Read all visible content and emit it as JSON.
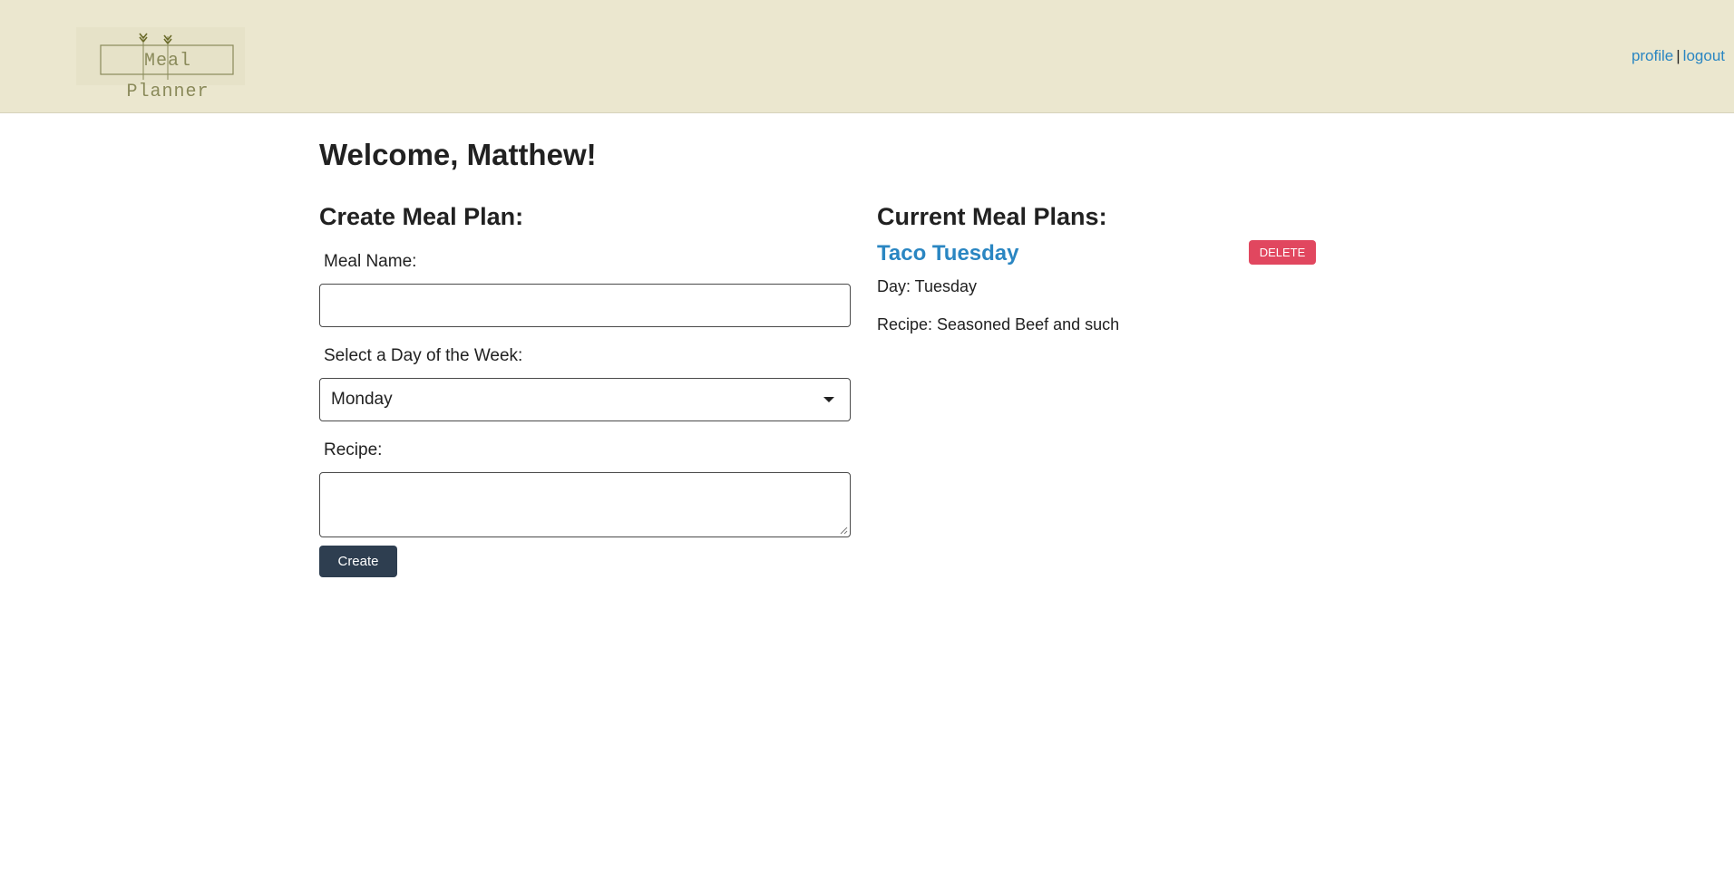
{
  "header": {
    "logo_text": "Meal Planner",
    "links": {
      "profile": "profile",
      "separator": "|",
      "logout": "logout"
    }
  },
  "main": {
    "welcome": "Welcome, Matthew!",
    "create_form": {
      "heading": "Create Meal Plan:",
      "meal_name_label": "Meal Name:",
      "meal_name_value": "",
      "day_label": "Select a Day of the Week:",
      "day_selected": "Monday",
      "recipe_label": "Recipe:",
      "recipe_value": "",
      "create_label": "Create"
    },
    "current_plans": {
      "heading": "Current Meal Plans:",
      "items": [
        {
          "title": "Taco Tuesday",
          "delete_label": "DELETE",
          "day_line": "Day: Tuesday",
          "recipe_line": "Recipe: Seasoned Beef and such"
        }
      ]
    }
  },
  "colors": {
    "header_bg": "#ebe7cf",
    "link": "#2a86c2",
    "create_button": "#2e3e50",
    "delete_button": "#e1475f"
  }
}
